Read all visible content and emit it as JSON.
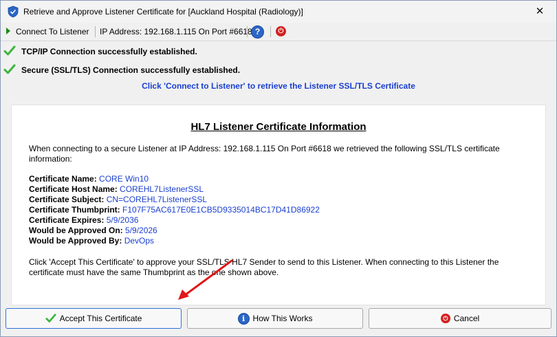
{
  "window": {
    "title": "Retrieve and Approve Listener Certificate for [Auckland Hospital (Radiology)]",
    "close_glyph": "✕"
  },
  "toolbar": {
    "connect_label": "Connect To Listener",
    "ip_text": "IP Address: 192.168.1.115 On Port #6618",
    "help_glyph": "?",
    "power_glyph": "⏻"
  },
  "status": [
    {
      "text": "TCP/IP Connection successfully established."
    },
    {
      "text": "Secure (SSL/TLS)  Connection successfully established."
    }
  ],
  "hint": "Click 'Connect to Listener' to retrieve the Listener SSL/TLS Certificate",
  "panel": {
    "title": "HL7 Listener Certificate Information",
    "intro": "When connecting to a secure Listener at IP Address: 192.168.1.115 On Port #6618 we retrieved the following SSL/TLS certificate information:",
    "fields": [
      {
        "label": "Certificate Name:",
        "value": "CORE Win10"
      },
      {
        "label": "Certificate Host Name:",
        "value": "COREHL7ListenerSSL"
      },
      {
        "label": "Certificate Subject:",
        "value": "CN=COREHL7ListenerSSL"
      },
      {
        "label": "Certificate Thumbprint:",
        "value": "F107F75AC617E0E1CB5D9335014BC17D41D86922"
      },
      {
        "label": "Certificate Expires:",
        "value": "5/9/2036"
      },
      {
        "label": "Would be Approved On:",
        "value": "5/9/2026"
      },
      {
        "label": "Would be Approved By:",
        "value": "DevOps"
      }
    ],
    "outro": "Click 'Accept This Certificate' to approve your SSL/TLS HL7 Sender to send to this Listener. When connecting to this Listener the certificate must have the same Thumbprint as the one shown above."
  },
  "buttons": {
    "accept": "Accept This Certificate",
    "how": "How This Works",
    "cancel": "Cancel",
    "info_glyph": "i",
    "cancel_glyph": "⏻"
  },
  "colors": {
    "link_blue": "#1a3fd0",
    "check_green": "#3cb43c",
    "arrow_red": "#e01818"
  }
}
